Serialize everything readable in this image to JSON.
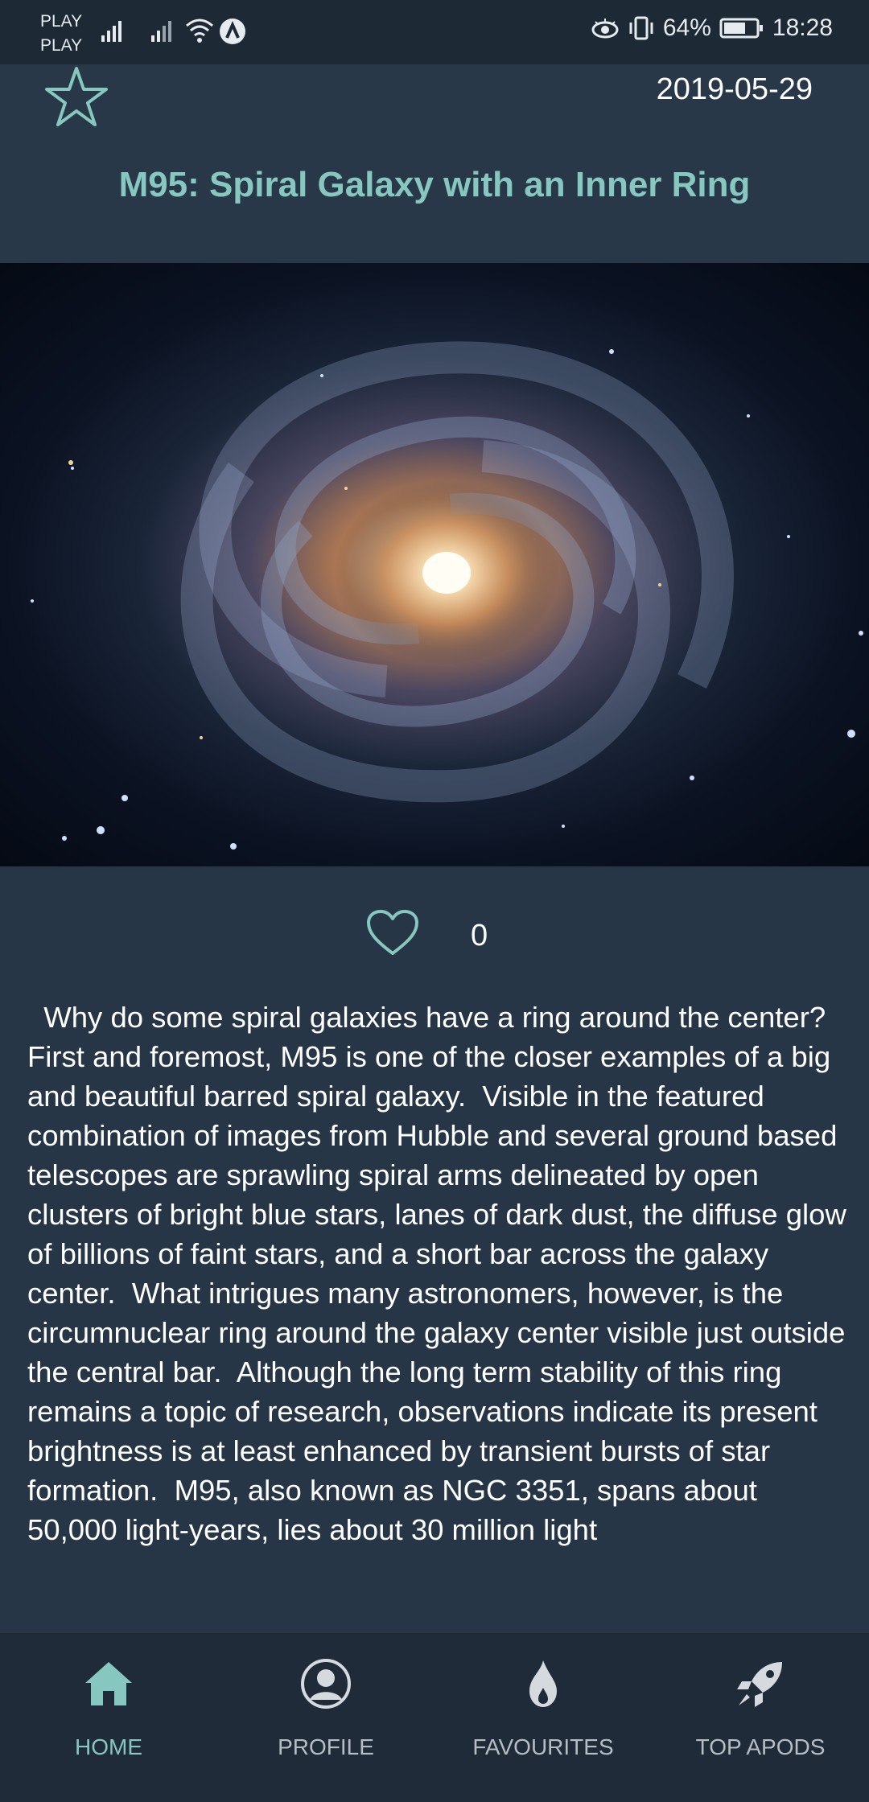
{
  "status_bar": {
    "carrier_line1": "PLAY",
    "carrier_line2": "PLAY",
    "battery": "64%",
    "time": "18:28"
  },
  "header": {
    "date": "2019-05-29",
    "title": "M95: Spiral Galaxy with an Inner Ring"
  },
  "likes": {
    "count": "0"
  },
  "description": "  Why do some spiral galaxies have a ring around the center?  First and foremost, M95 is one of the closer examples of a big and beautiful barred spiral galaxy.  Visible in the featured combination of images from Hubble and several ground based telescopes are sprawling spiral arms delineated by open clusters of bright blue stars, lanes of dark dust, the diffuse glow of billions of faint stars, and a short bar across the galaxy center.  What intrigues many astronomers, however, is the circumnuclear ring around the galaxy center visible just outside the central bar.  Although the long term stability of this ring remains a topic of research, observations indicate its present brightness is at least enhanced by transient bursts of star formation.  M95, also known as NGC 3351, spans about 50,000 light-years, lies about 30 million light",
  "nav": {
    "home": "HOME",
    "profile": "PROFILE",
    "favourites": "FAVOURITES",
    "top_apods": "TOP APODS"
  },
  "colors": {
    "accent": "#86c7c0",
    "background": "#263646",
    "nav_background": "#1f2b38"
  }
}
